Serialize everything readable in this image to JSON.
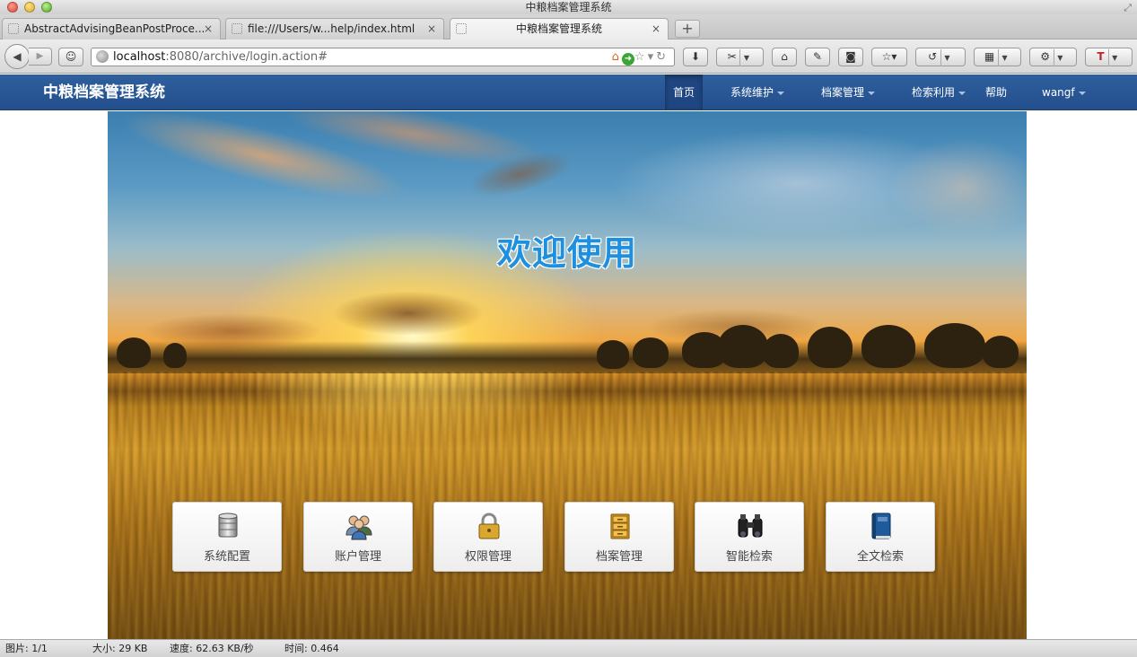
{
  "window": {
    "title": "中粮档案管理系统"
  },
  "tabs": [
    {
      "label": "AbstractAdvisingBeanPostProce...",
      "close": "×"
    },
    {
      "label": "file:///Users/w...help/index.html",
      "close": "×"
    },
    {
      "label": "中粮档案管理系统",
      "close": "×"
    }
  ],
  "new_tab_label": "+",
  "address": {
    "host": "localhost",
    "rest": ":8080/archive/login.action#"
  },
  "app": {
    "brand": "中粮档案管理系统",
    "nav": [
      {
        "label": "首页",
        "dropdown": false,
        "active": true
      },
      {
        "label": "系统维护",
        "dropdown": true
      },
      {
        "label": "档案管理",
        "dropdown": true
      },
      {
        "label": "检索利用",
        "dropdown": true
      },
      {
        "label": "帮助",
        "dropdown": false
      },
      {
        "label": "wangf",
        "dropdown": true
      }
    ]
  },
  "hero": {
    "welcome": "欢迎使用",
    "tiles": [
      {
        "label": "系统配置",
        "icon": "database-icon"
      },
      {
        "label": "账户管理",
        "icon": "users-icon"
      },
      {
        "label": "权限管理",
        "icon": "padlock-icon"
      },
      {
        "label": "档案管理",
        "icon": "file-cabinet-icon"
      },
      {
        "label": "智能检索",
        "icon": "binoculars-icon"
      },
      {
        "label": "全文检索",
        "icon": "book-icon"
      }
    ]
  },
  "status": {
    "image": "图片: 1/1",
    "size": "大小: 29 KB",
    "speed": "速度: 62.63 KB/秒",
    "time": "时间: 0.464"
  },
  "colors": {
    "app_nav": "#2a5a96",
    "welcome_text": "#1f8fe0"
  }
}
